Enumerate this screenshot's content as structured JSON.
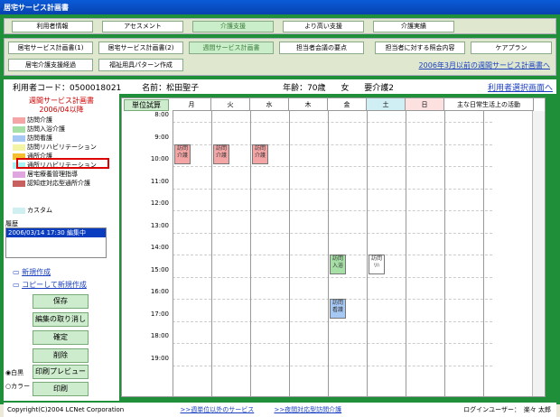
{
  "window": {
    "title": "居宅サービス計画書"
  },
  "tabs_main": [
    "利用者情報",
    "アセスメント",
    "介護支援",
    "より高い支援",
    "介護実績"
  ],
  "tabs_sub_row1": [
    "居宅サービス計画書(1)",
    "居宅サービス計画書(2)",
    "週間サービス計画書",
    "担当者会議の要点",
    "担当者に対する照会内容",
    "ケアプラン"
  ],
  "tabs_sub_row2": [
    "居宅介護支援経過",
    "福祉用具パターン作成"
  ],
  "link_old_plan": "2006年3月以前の週間サービス計画書へ",
  "user": {
    "code_label": "利用者コード：",
    "code": "0500018021",
    "name_label": "名前：",
    "name": "松田聖子",
    "age_label": "年齢：",
    "age": "70歳",
    "sex": "女",
    "care_level": "要介護2",
    "select_link": "利用者選択画面へ"
  },
  "left": {
    "plan_title": "週間サービス計画書",
    "plan_subtitle": "2006/04以降",
    "legend": [
      {
        "label": "訪問介護",
        "color": "#f4a6a6"
      },
      {
        "label": "訪問入浴介護",
        "color": "#a6e0a6"
      },
      {
        "label": "訪問看護",
        "color": "#a6c8f4"
      },
      {
        "label": "訪問リハビリテーション",
        "color": "#f4f4a6"
      },
      {
        "label": "通所介護",
        "color": "#f4c030"
      },
      {
        "label": "通所リハビリテーション",
        "color": "#a6f4f4"
      },
      {
        "label": "居宅療養管理指導",
        "color": "#e0a6e0"
      },
      {
        "label": "認知症対応型通所介護",
        "color": "#c86060"
      }
    ],
    "custom": "カスタム",
    "custom_color": "#cfeff0",
    "history_label": "履歴",
    "history_item": "2006/03/14 17:30 編集中",
    "new": "新規作成",
    "copy_new": "コピーして新規作成",
    "save": "保存",
    "cancel_edit": "編集の取り消し",
    "confirm": "確定",
    "delete": "削除",
    "radio_bw": "白黒",
    "radio_color": "カラー",
    "print_preview": "印刷プレビュー",
    "print": "印刷"
  },
  "calendar": {
    "calc_btn": "単位試算",
    "days": [
      "月",
      "火",
      "水",
      "木",
      "金",
      "土",
      "日"
    ],
    "daily_life": "主な日常生活上の活動",
    "times": [
      "8:00",
      "9:00",
      "10:00",
      "11:00",
      "12:00",
      "13:00",
      "14:00",
      "15:00",
      "16:00",
      "17:00",
      "18:00",
      "19:00"
    ],
    "events": [
      {
        "day": 0,
        "hour": 9,
        "top_label": "訪問",
        "bottom_label": "介護",
        "color": "#f4a6a6"
      },
      {
        "day": 1,
        "hour": 9,
        "top_label": "訪問",
        "bottom_label": "介護",
        "color": "#f4a6a6"
      },
      {
        "day": 2,
        "hour": 9,
        "top_label": "訪問",
        "bottom_label": "介護",
        "color": "#f4a6a6"
      },
      {
        "day": 4,
        "hour": 14,
        "top_label": "訪問",
        "bottom_label": "入浴",
        "color": "#a6e0a6"
      },
      {
        "day": 5,
        "hour": 14,
        "top_label": "訪問",
        "bottom_label": "ﾘﾊ",
        "color": "#ffffff"
      },
      {
        "day": 4,
        "hour": 16,
        "top_label": "訪問",
        "bottom_label": "看護",
        "color": "#a6c8f4"
      }
    ]
  },
  "status": {
    "copyright": "Copyright(C)2004 LCNet Corporation",
    "link_other": ">>週単位以外のサービス",
    "link_night": ">>夜間対応型訪問介護",
    "login_label": "ログインユーザー：",
    "login_user": "楽々 太郎"
  }
}
